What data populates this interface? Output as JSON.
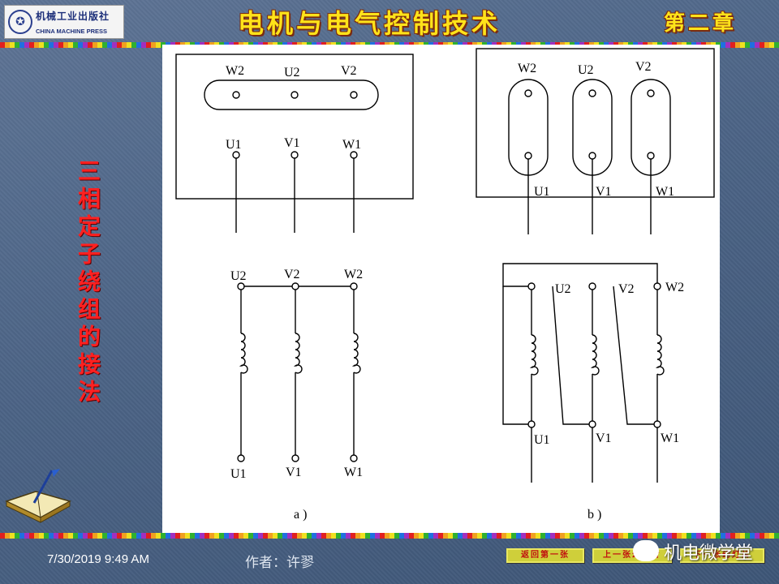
{
  "header": {
    "publisher_logo": {
      "name_cn": "机械工业出版社",
      "name_en": "CHINA MACHINE PRESS"
    },
    "title": "电机与电气控制技术",
    "chapter": "第二章"
  },
  "side_title": "三相定子绕组的接法",
  "figure": {
    "panel_a": {
      "top_labels": [
        "W2",
        "U2",
        "V2"
      ],
      "bottom_labels": [
        "U1",
        "V1",
        "W1"
      ],
      "schematic_top_labels": [
        "U2",
        "V2",
        "W2"
      ],
      "schematic_bottom_labels": [
        "U1",
        "V1",
        "W1"
      ],
      "caption": "a )"
    },
    "panel_b": {
      "top_labels": [
        "W2",
        "U2",
        "V2"
      ],
      "bottom_labels": [
        "U1",
        "V1",
        "W1"
      ],
      "schematic_top_labels": [
        "U2",
        "V2",
        "W2"
      ],
      "schematic_bottom_labels": [
        "U1",
        "V1",
        "W1"
      ],
      "caption": "b )"
    }
  },
  "footer": {
    "date": "7/30/2019 9:49 AM",
    "author": "作者：许翏",
    "nav": {
      "first": "返回第一张",
      "prev": "上一张幻灯片",
      "next": "下一张幻灯片"
    },
    "watermark": "机电微学堂"
  },
  "colors": {
    "title": "#ffe31a",
    "side_title": "#ff2020",
    "background": "#4c6486"
  }
}
